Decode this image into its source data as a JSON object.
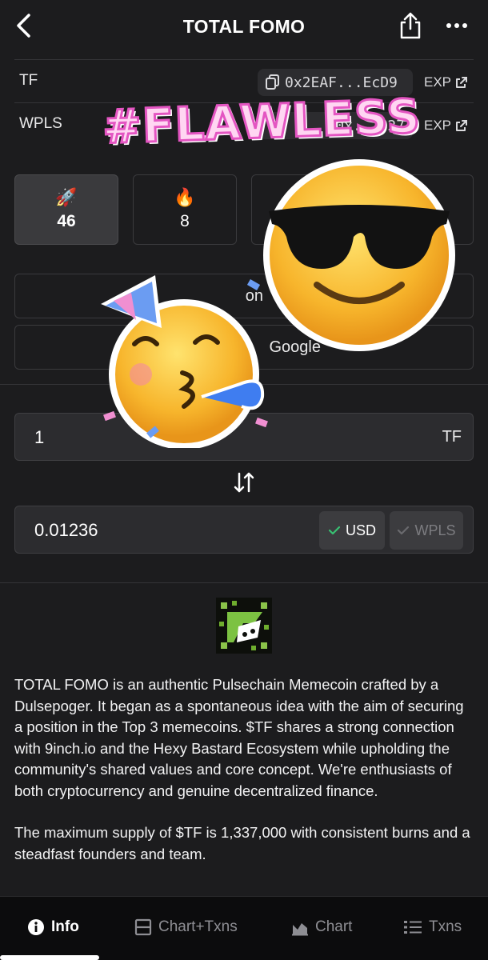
{
  "header": {
    "title": "TOTAL FOMO",
    "back_icon": "chevron-left-icon",
    "share_icon": "share-icon",
    "more_icon": "more-dots-icon"
  },
  "addresses": [
    {
      "label": "TF",
      "address": "0x2EAF...EcD9",
      "explorer": "EXP"
    },
    {
      "label": "WPLS",
      "address": "0x...a27",
      "explorer": "EXP"
    }
  ],
  "reactions": [
    {
      "emoji": "🚀",
      "count": "46",
      "icon": "rocket-icon"
    },
    {
      "emoji": "🔥",
      "count": "8",
      "icon": "fire-icon"
    }
  ],
  "buttons": {
    "first_partial": "on",
    "google_partial": "Google"
  },
  "converter": {
    "from_value": "1",
    "from_unit": "TF",
    "to_value": "0.01236",
    "usd_label": "USD",
    "wpls_label": "WPLS"
  },
  "description": [
    "TOTAL FOMO is an authentic Pulsechain Memecoin crafted by a Dulsepoger. It began as a spontaneous idea with the aim of securing a position in the Top 3 memecoins. $TF shares a strong connection with 9inch.io and the Hexy Bastard Ecosystem while upholding the community's shared values and core concept. We're enthusiasts of both cryptocurrency and genuine decentralized finance.",
    "The maximum supply of $TF is 1,337,000 with consistent burns and a steadfast founders and team."
  ],
  "overlay": {
    "sticker_text": "#FLAWLESS"
  },
  "tabs": [
    {
      "label": "Info",
      "icon": "info-icon",
      "active": true
    },
    {
      "label": "Chart+Txns",
      "icon": "split-view-icon",
      "active": false
    },
    {
      "label": "Chart",
      "icon": "area-chart-icon",
      "active": false
    },
    {
      "label": "Txns",
      "icon": "list-icon",
      "active": false
    }
  ],
  "colors": {
    "background": "#1c1c1e",
    "surface": "#2c2c2f",
    "check_green": "#38c172",
    "sticker_pink": "#e455c2"
  }
}
